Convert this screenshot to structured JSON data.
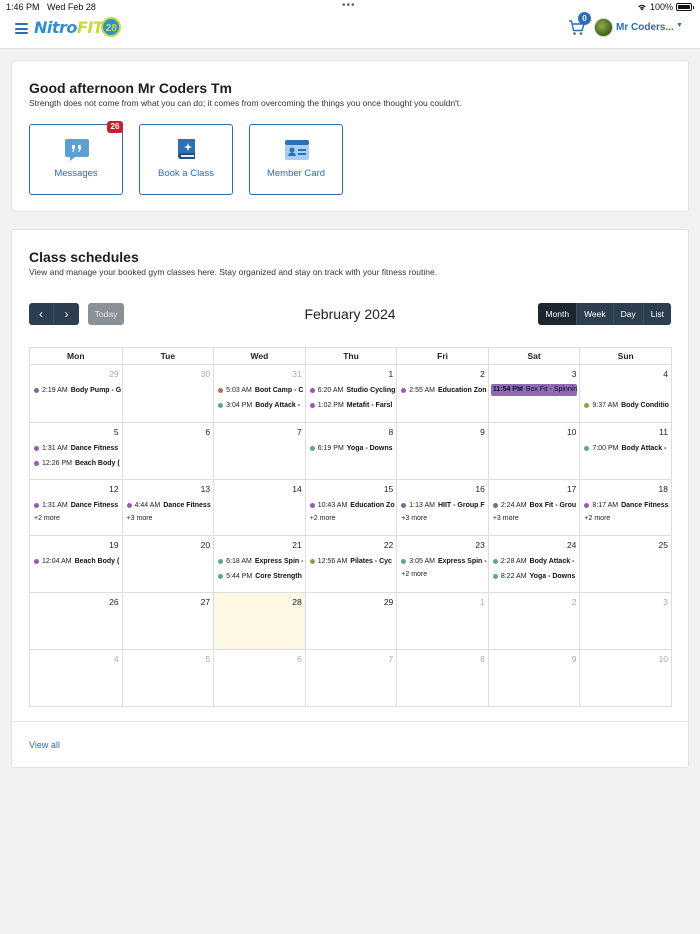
{
  "status": {
    "time": "1:46 PM",
    "date": "Wed Feb 28",
    "battery": "100%"
  },
  "nav": {
    "logo_nitro": "Nitro",
    "logo_fit": "FIT",
    "logo_num": "28",
    "cart_count": "0",
    "username": "Mr Coders..."
  },
  "greeting": {
    "title": "Good afternoon Mr Coders Tm",
    "subtitle": "Strength does not come from what you can do; it comes from overcoming the things you once thought you couldn't."
  },
  "tiles": [
    {
      "label": "Messages",
      "badge": "26",
      "icon": "chat-bubble-icon"
    },
    {
      "label": "Book a Class",
      "icon": "book-sparkle-icon"
    },
    {
      "label": "Member Card",
      "icon": "id-card-icon"
    }
  ],
  "schedule": {
    "title": "Class schedules",
    "subtitle": "View and manage your booked gym classes here. Stay organized and stay on track with your fitness routine.",
    "today_label": "Today",
    "month_title": "February 2024",
    "views": [
      "Month",
      "Week",
      "Day",
      "List"
    ],
    "weekdays": [
      "Mon",
      "Tue",
      "Wed",
      "Thu",
      "Fri",
      "Sat",
      "Sun"
    ],
    "view_all": "View all"
  },
  "colors": {
    "primary": "#2a6db5",
    "dark": "#2c3e50",
    "purple": "#9b59b6",
    "green": "#5faa7a",
    "brown": "#b4705a",
    "olive": "#9a9a4a",
    "slate": "#6d6d9e",
    "bar": "#8e6ab8"
  },
  "weeks": [
    [
      {
        "d": "29",
        "other": true,
        "events": [
          {
            "time": "2:19 AM",
            "name": "Body Pump - G",
            "color": "slate"
          }
        ]
      },
      {
        "d": "30",
        "other": true,
        "events": []
      },
      {
        "d": "31",
        "other": true,
        "events": [
          {
            "time": "5:03 AM",
            "name": "Boot Camp - C",
            "color": "brown"
          },
          {
            "time": "3:04 PM",
            "name": "Body Attack -",
            "color": "green"
          }
        ]
      },
      {
        "d": "1",
        "events": [
          {
            "time": "6:20 AM",
            "name": "Studio Cycling",
            "color": "purple"
          },
          {
            "time": "1:02 PM",
            "name": "Metafit - Farsl",
            "color": "purple"
          }
        ]
      },
      {
        "d": "2",
        "events": [
          {
            "time": "2:55 AM",
            "name": "Education Zon",
            "color": "purple"
          }
        ]
      },
      {
        "d": "3",
        "bar": {
          "time": "11:54 PM",
          "name": "Box Fit - Spinning Studio"
        },
        "events": []
      },
      {
        "d": "4",
        "events": [
          {
            "time": "9:37 AM",
            "name": "Body Conditio",
            "color": "olive",
            "slot": 2
          }
        ]
      }
    ],
    [
      {
        "d": "5",
        "events": [
          {
            "time": "1:31 AM",
            "name": "Dance Fitness",
            "color": "purple"
          },
          {
            "time": "12:26 PM",
            "name": "Beach Body (",
            "color": "purple"
          }
        ]
      },
      {
        "d": "6",
        "events": []
      },
      {
        "d": "7",
        "events": []
      },
      {
        "d": "8",
        "events": [
          {
            "time": "6:19 PM",
            "name": "Yoga - Downs",
            "color": "green"
          }
        ]
      },
      {
        "d": "9",
        "events": []
      },
      {
        "d": "10",
        "events": []
      },
      {
        "d": "11",
        "events": [
          {
            "time": "7:00 PM",
            "name": "Body Attack -",
            "color": "green"
          }
        ]
      }
    ],
    [
      {
        "d": "12",
        "events": [
          {
            "time": "1:31 AM",
            "name": "Dance Fitness",
            "color": "purple"
          }
        ],
        "more": "+2 more"
      },
      {
        "d": "13",
        "events": [
          {
            "time": "4:44 AM",
            "name": "Dance Fitness",
            "color": "purple"
          }
        ],
        "more": "+3 more"
      },
      {
        "d": "14",
        "events": []
      },
      {
        "d": "15",
        "events": [
          {
            "time": "10:43 AM",
            "name": "Education Zo",
            "color": "purple"
          }
        ],
        "more": "+2 more"
      },
      {
        "d": "16",
        "events": [
          {
            "time": "1:13 AM",
            "name": "HIIT - Group F",
            "color": "slate"
          }
        ],
        "more": "+3 more"
      },
      {
        "d": "17",
        "events": [
          {
            "time": "2:24 AM",
            "name": "Box Fit - Grou",
            "color": "slate"
          }
        ],
        "more": "+3 more"
      },
      {
        "d": "18",
        "events": [
          {
            "time": "8:17 AM",
            "name": "Dance Fitness",
            "color": "purple"
          }
        ],
        "more": "+2 more"
      }
    ],
    [
      {
        "d": "19",
        "events": [
          {
            "time": "12:04 AM",
            "name": "Beach Body (",
            "color": "purple"
          }
        ]
      },
      {
        "d": "20",
        "events": []
      },
      {
        "d": "21",
        "events": [
          {
            "time": "6:18 AM",
            "name": "Express Spin -",
            "color": "green"
          },
          {
            "time": "5:44 PM",
            "name": "Core Strength",
            "color": "green"
          }
        ]
      },
      {
        "d": "22",
        "events": [
          {
            "time": "12:56 AM",
            "name": "Pilates - Cyc",
            "color": "olive"
          }
        ]
      },
      {
        "d": "23",
        "events": [
          {
            "time": "3:05 AM",
            "name": "Express Spin -",
            "color": "green"
          }
        ],
        "more": "+2 more"
      },
      {
        "d": "24",
        "events": [
          {
            "time": "2:28 AM",
            "name": "Body Attack -",
            "color": "green"
          },
          {
            "time": "8:22 AM",
            "name": "Yoga - Downs",
            "color": "green"
          }
        ]
      },
      {
        "d": "25",
        "events": []
      }
    ],
    [
      {
        "d": "26",
        "events": []
      },
      {
        "d": "27",
        "events": []
      },
      {
        "d": "28",
        "today": true,
        "events": []
      },
      {
        "d": "29",
        "events": []
      },
      {
        "d": "1",
        "other": true,
        "events": []
      },
      {
        "d": "2",
        "other": true,
        "events": []
      },
      {
        "d": "3",
        "other": true,
        "events": []
      }
    ],
    [
      {
        "d": "4",
        "other": true,
        "events": []
      },
      {
        "d": "5",
        "other": true,
        "events": []
      },
      {
        "d": "6",
        "other": true,
        "events": []
      },
      {
        "d": "7",
        "other": true,
        "events": []
      },
      {
        "d": "8",
        "other": true,
        "events": []
      },
      {
        "d": "9",
        "other": true,
        "events": []
      },
      {
        "d": "10",
        "other": true,
        "events": []
      }
    ]
  ]
}
